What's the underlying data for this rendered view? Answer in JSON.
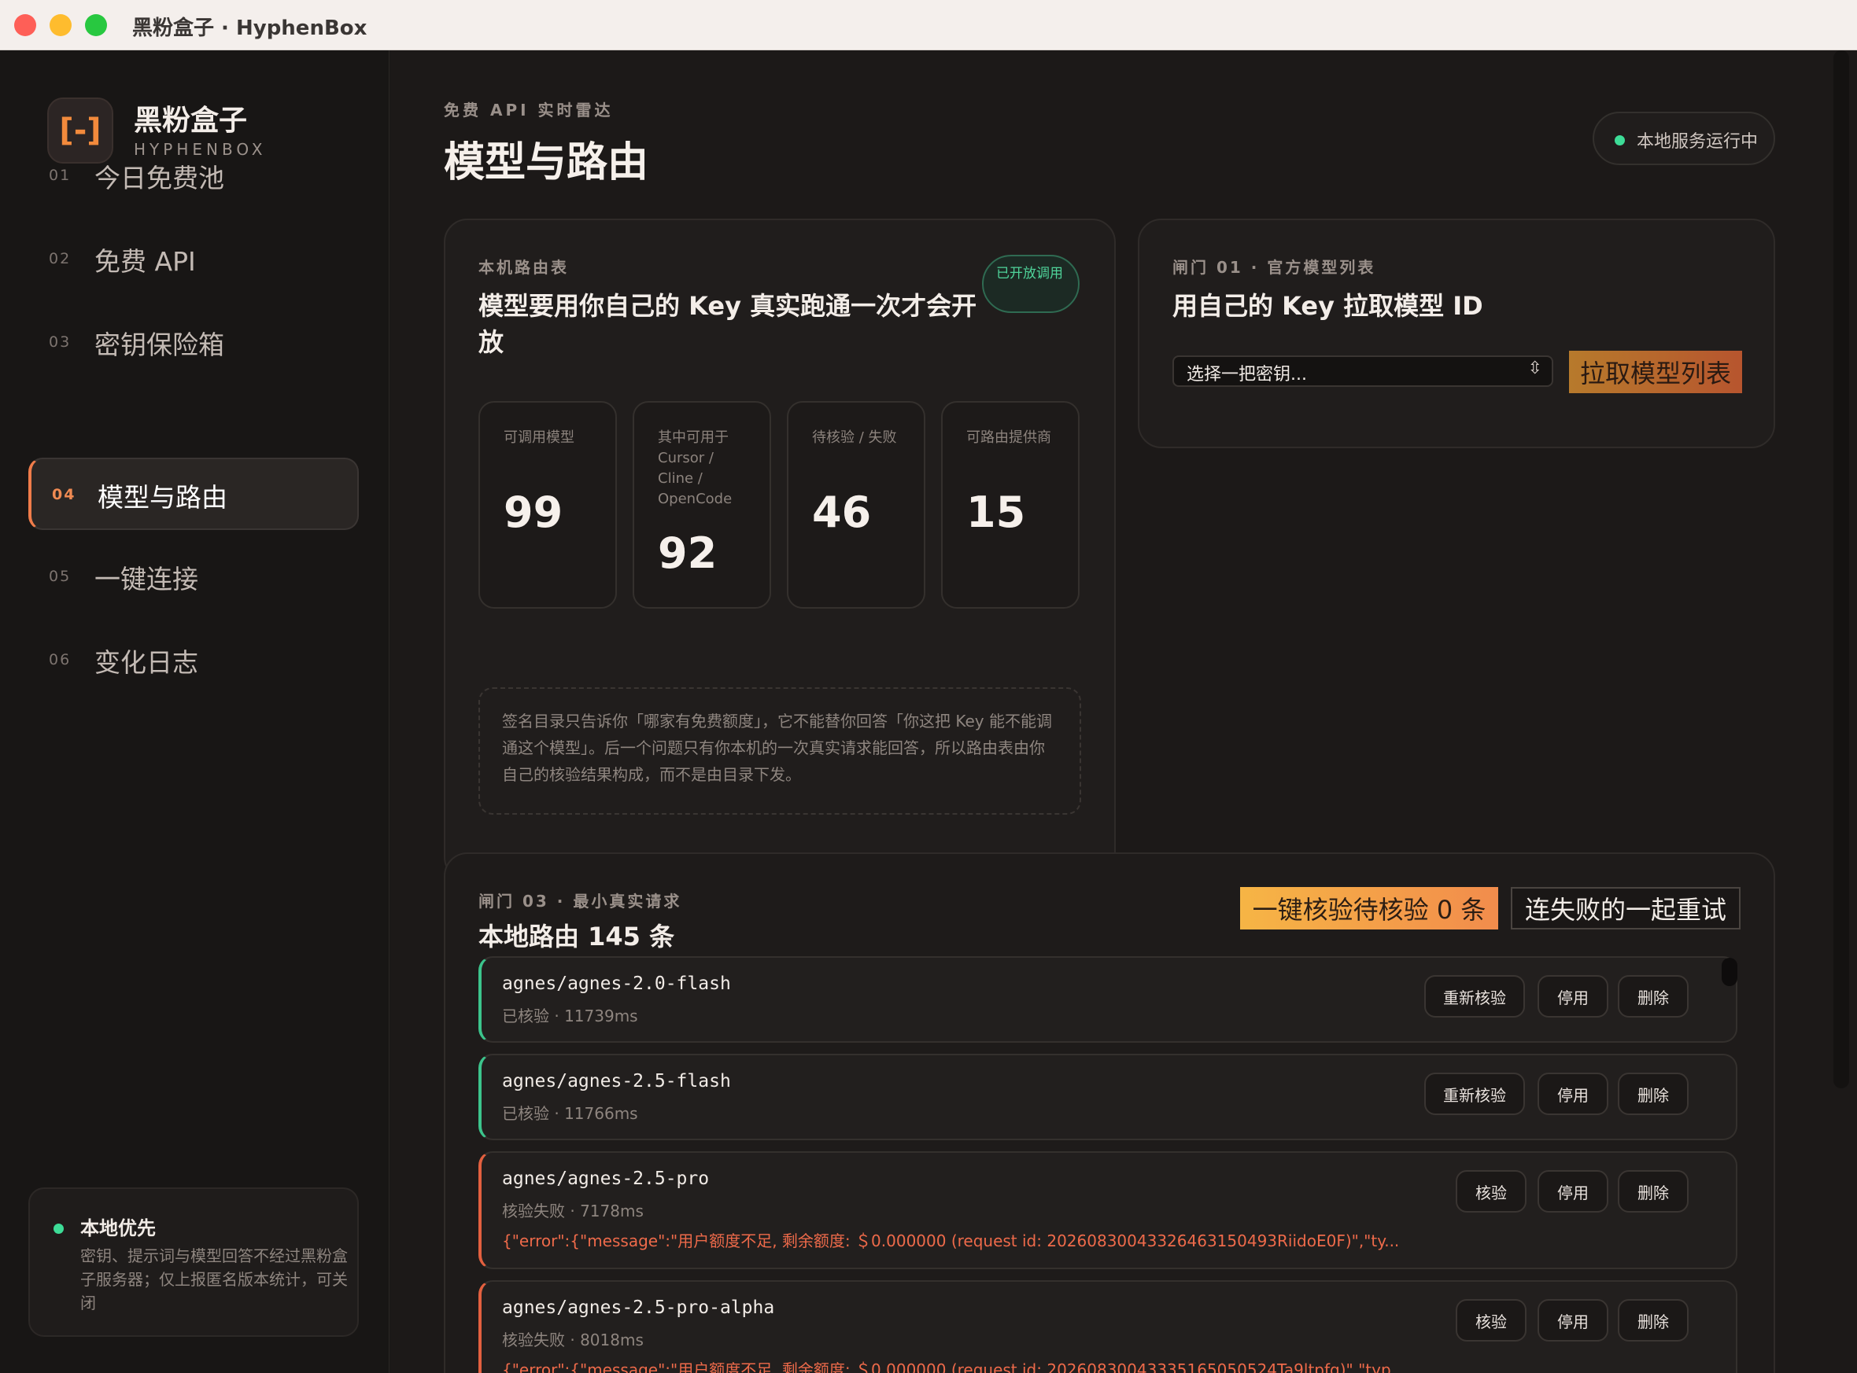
{
  "window": {
    "title": "黑粉盒子 · HyphenBox"
  },
  "sidebar": {
    "logo_glyph": "[-]",
    "brand_cn": "黑粉盒子",
    "brand_en": "HYPHENBOX",
    "items": [
      {
        "num": "01",
        "label": "今日免费池"
      },
      {
        "num": "02",
        "label": "免费 API"
      },
      {
        "num": "03",
        "label": "密钥保险箱"
      },
      {
        "num": "04",
        "label": "模型与路由",
        "active": true
      },
      {
        "num": "05",
        "label": "一键连接"
      },
      {
        "num": "06",
        "label": "变化日志"
      }
    ],
    "local": {
      "title": "本地优先",
      "desc": "密钥、提示词与模型回答不经过黑粉盒子服务器；仅上报匿名版本统计，可关闭"
    }
  },
  "header": {
    "eyebrow": "免费 API 实时雷达",
    "title": "模型与路由",
    "status": "本地服务运行中"
  },
  "route_table": {
    "eyebrow": "本机路由表",
    "title": "模型要用你自己的 Key 真实跑通一次才会开放",
    "badge": "已开放调用",
    "stats": [
      {
        "label": "可调用模型",
        "value": "99"
      },
      {
        "label": "其中可用于 Cursor / Cline / OpenCode",
        "value": "92"
      },
      {
        "label": "待核验 / 失败",
        "value": "46"
      },
      {
        "label": "可路由提供商",
        "value": "15"
      }
    ],
    "note": "签名目录只告诉你「哪家有免费额度」，它不能替你回答「你这把 Key 能不能调通这个模型」。后一个问题只有你本机的一次真实请求能回答，所以路由表由你自己的核验结果构成，而不是由目录下发。"
  },
  "gate1": {
    "eyebrow": "闸门 01 · 官方模型列表",
    "title": "用自己的 Key 拉取模型 ID",
    "select_value": "选择一把密钥...",
    "pull_button": "拉取模型列表"
  },
  "gate3": {
    "eyebrow": "闸门 03 · 最小真实请求",
    "title": "本地路由 145 条",
    "verify_all_button": "一键核验待核验 0 条",
    "retry_button": "连失败的一起重试",
    "routes": [
      {
        "name": "agnes/agnes-2.0-flash",
        "meta": "已核验 · 11739ms",
        "status": "ok",
        "verify": "重新核验",
        "disable": "停用",
        "delete": "删除"
      },
      {
        "name": "agnes/agnes-2.5-flash",
        "meta": "已核验 · 11766ms",
        "status": "ok",
        "verify": "重新核验",
        "disable": "停用",
        "delete": "删除"
      },
      {
        "name": "agnes/agnes-2.5-pro",
        "meta": "核验失败 · 7178ms",
        "status": "fail",
        "error": "{\"error\":{\"message\":\"用户额度不足, 剩余额度: ＄0.000000 (request id: 20260830043326463150493RiidoE0F)\",\"ty...",
        "verify": "核验",
        "disable": "停用",
        "delete": "删除"
      },
      {
        "name": "agnes/agnes-2.5-pro-alpha",
        "meta": "核验失败 · 8018ms",
        "status": "fail",
        "error": "{\"error\":{\"message\":\"用户额度不足, 剩余额度: ＄0.000000 (request id: 20260830043335165050524Ta9ltpfq)\",\"typ...",
        "verify": "核验",
        "disable": "停用",
        "delete": "删除"
      }
    ]
  },
  "colors": {
    "accent": "#f07c4a",
    "ok": "#3cc48c",
    "fail": "#e3603f",
    "status_dot": "#3ddc97"
  }
}
